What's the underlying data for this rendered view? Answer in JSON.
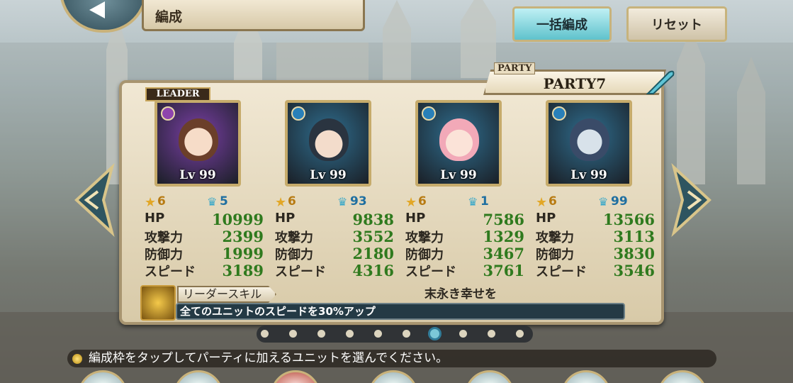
{
  "header": {
    "title": "編成",
    "bulk_button": "一括編成",
    "reset_button": "リセット"
  },
  "party": {
    "small_label": "PARTY",
    "name": "PARTY7"
  },
  "leader_tag": "LEADER",
  "units": [
    {
      "level": "Lv 99",
      "rarity": "6",
      "awaken": "5",
      "hp": "10999",
      "atk": "2399",
      "def": "1999",
      "spd": "3189",
      "frame_color": "#7b3fa6",
      "elem_color": "#8e44ad"
    },
    {
      "level": "Lv 99",
      "rarity": "6",
      "awaken": "93",
      "hp": "9838",
      "atk": "3552",
      "def": "2180",
      "spd": "4316",
      "frame_color": "#2f6e8f",
      "elem_color": "#2980b9"
    },
    {
      "level": "Lv 99",
      "rarity": "6",
      "awaken": "1",
      "hp": "7586",
      "atk": "1329",
      "def": "3467",
      "spd": "3761",
      "frame_color": "#2f6e8f",
      "elem_color": "#2980b9"
    },
    {
      "level": "Lv 99",
      "rarity": "6",
      "awaken": "99",
      "hp": "13566",
      "atk": "3113",
      "def": "3830",
      "spd": "3546",
      "frame_color": "#2f6e8f",
      "elem_color": "#2980b9"
    }
  ],
  "stat_labels": {
    "hp": "HP",
    "atk": "攻撃力",
    "def": "防御力",
    "spd": "スピード"
  },
  "skill": {
    "label": "リーダースキル",
    "name": "末永き幸せを",
    "description": "全てのユニットのスピードを30%アップ"
  },
  "pagination": {
    "total": 10,
    "current": 7
  },
  "hint": "編成枠をタップしてパーティに加えるユニットを選んでください。"
}
